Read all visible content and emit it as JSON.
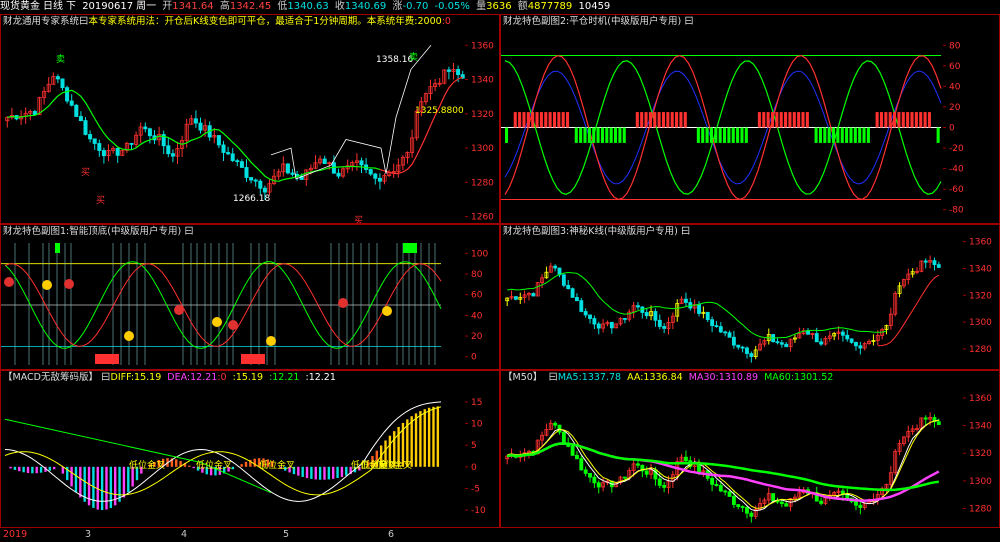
{
  "quote": {
    "name": "现货黄金",
    "period": "日线",
    "dir": "下",
    "date": "20190617",
    "weekday": "周一",
    "open_label": "开",
    "open": "1341.64",
    "high_label": "高",
    "high": "1342.45",
    "low_label": "低",
    "low": "1340.63",
    "close_label": "收",
    "close": "1340.69",
    "chg_label": "涨",
    "chg": "-0.70",
    "pct": "-0.05%",
    "vol_label": "量",
    "vol": "3636",
    "amt_label": "额",
    "amt": "4877789",
    "extra": "10459"
  },
  "main": {
    "name": "财龙通用专家系统",
    "sep": "曰",
    "desc": "本专家系统用法：开仓后K线变色即可平仓，最适合于1分钟周期。本系统年费:2000",
    "colon": ":0",
    "ticks": [
      "1360",
      "1340",
      "1320",
      "1300",
      "1280",
      "1260"
    ],
    "labels": {
      "hi": "1358.16",
      "lo": "1266.18",
      "tgt": "1325.8800",
      "sell1": "卖",
      "sell2": "卖",
      "buy1": "买",
      "buy2": "买"
    }
  },
  "sub2": {
    "name": "财龙特色副图2:平仓时机(中级版用户专用)",
    "sep": "曰",
    "ticks": [
      "80",
      "60",
      "40",
      "20",
      "0",
      "-20",
      "-40",
      "-60",
      "-80"
    ]
  },
  "sub1": {
    "name": "财龙特色副图1:智能顶底(中级版用户专用)",
    "sep": "曰",
    "ticks": [
      "100",
      "80",
      "60",
      "40",
      "20",
      "0"
    ]
  },
  "sub3": {
    "name": "财龙特色副图3:神秘K线(中级版用户专用)",
    "sep": "曰",
    "ticks": [
      "1360",
      "1340",
      "1320",
      "1300",
      "1280"
    ]
  },
  "macd": {
    "name": "【MACD无敌筹码版】",
    "sep": "曰",
    "diff_label": "DIFF:",
    "diff": "15.19",
    "dea_label": "DEA:",
    "dea": "12.21",
    "zero": ":0",
    "v1": ":15.19",
    "v2": ":12.21",
    "v3": ":12.21",
    "ticks": [
      "15",
      "10",
      "5",
      "0",
      "-5",
      "-10"
    ],
    "labels": [
      "低位金叉",
      "低位金叉",
      "低位金叉",
      "低位金叉",
      "低位金叉",
      "低位金叉"
    ]
  },
  "m50": {
    "name": "【M50】",
    "sep": "曰",
    "ma5_label": "MA5:",
    "ma5": "1337.78",
    "aa_label": "AA:",
    "aa": "1336.84",
    "ma30_label": "MA30:",
    "ma30": "1310.89",
    "ma60_label": "MA60:",
    "ma60": "1301.52",
    "ticks": [
      "1360",
      "1340",
      "1320",
      "1300",
      "1280"
    ]
  },
  "dates": [
    "2019",
    "3",
    "4",
    "5",
    "6"
  ],
  "colors": {
    "up": "#ff3030",
    "down": "#00e0e0",
    "frame": "#a00000",
    "yellow": "#ffff00",
    "green": "#00ff00",
    "magenta": "#ff40ff",
    "white": "#ffffff"
  }
}
